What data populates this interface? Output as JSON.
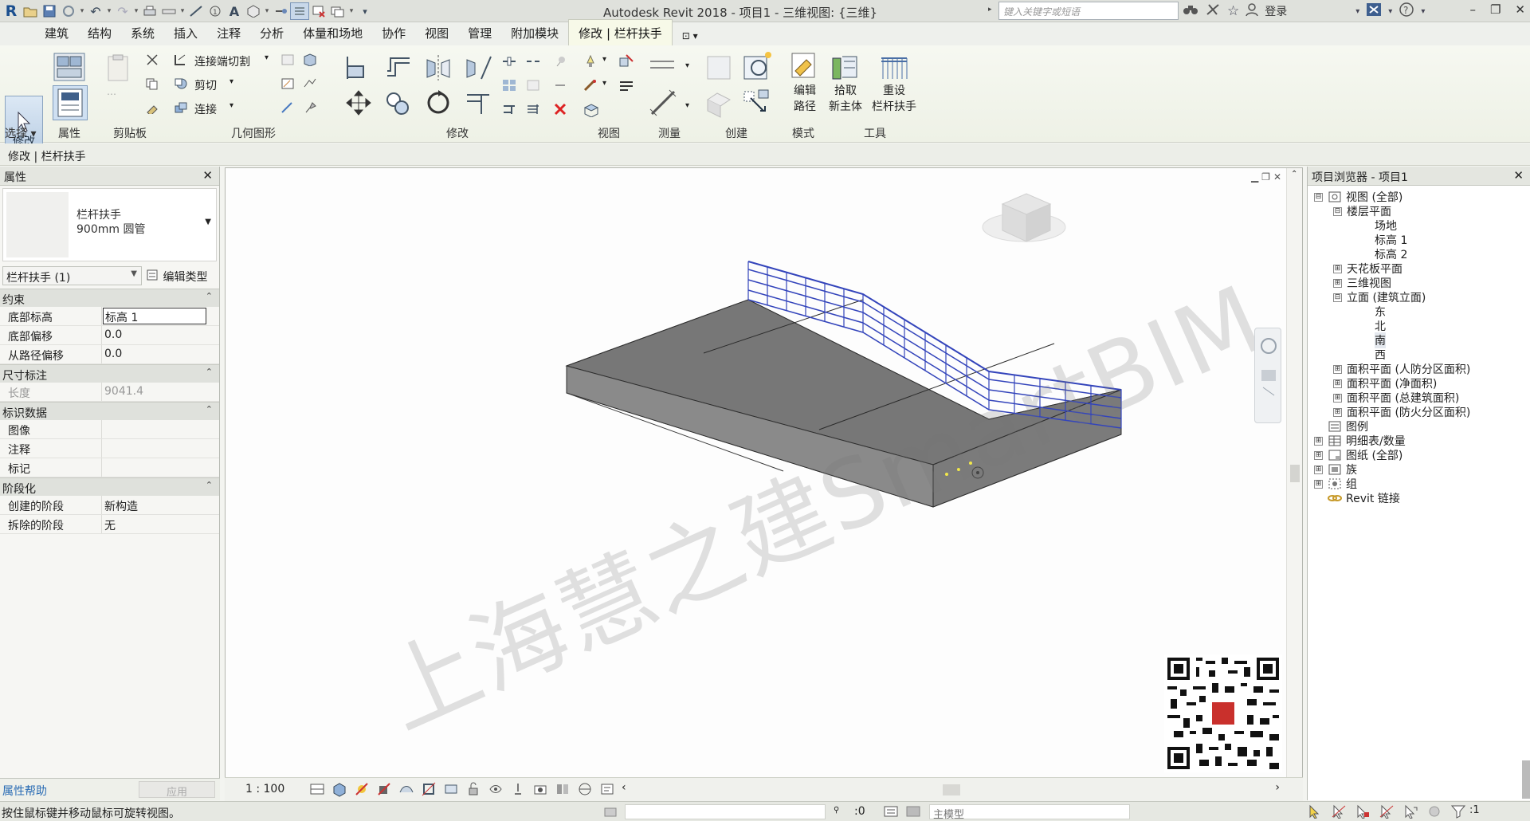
{
  "app": {
    "title": "Autodesk Revit 2018 -    项目1 - 三维视图: {三维}",
    "search_placeholder": "键入关键字或短语",
    "login": "登录"
  },
  "quick_access": {
    "icons": [
      "revit-logo-icon",
      "open-icon",
      "save-icon",
      "sync-icon",
      "undo-icon",
      "redo-icon",
      "print-icon",
      "measure-icon",
      "dimension-icon",
      "tag-icon",
      "text-icon",
      "3d-view-icon",
      "section-icon",
      "thin-lines-icon",
      "close-hidden-icon",
      "switch-windows-icon",
      "customize-icon"
    ]
  },
  "tabs": [
    {
      "label": "建筑"
    },
    {
      "label": "结构"
    },
    {
      "label": "系统"
    },
    {
      "label": "插入"
    },
    {
      "label": "注释"
    },
    {
      "label": "分析"
    },
    {
      "label": "体量和场地"
    },
    {
      "label": "协作"
    },
    {
      "label": "视图"
    },
    {
      "label": "管理"
    },
    {
      "label": "附加模块"
    },
    {
      "label": "修改 | 栏杆扶手"
    }
  ],
  "ribbon": {
    "modify_label": "修改",
    "select_label": "选择 ▾",
    "properties_label": "属性",
    "clipboard_label": "剪贴板",
    "geometry_label": "几何图形",
    "modify_panel_label": "修改",
    "view_panel_label": "视图",
    "measure_panel_label": "测量",
    "create_panel_label": "创建",
    "mode_panel_label": "模式",
    "tools_panel_label": "工具",
    "cope_label": "连接端切割",
    "cut_label": "剪切",
    "join_label": "连接",
    "edit_path_label": "编辑\n路径",
    "edit_path_l1": "编辑",
    "edit_path_l2": "路径",
    "pick_host_l1": "拾取",
    "pick_host_l2": "新主体",
    "reset_rail_l1": "重设",
    "reset_rail_l2": "栏杆扶手"
  },
  "options_bar": {
    "context": "修改 | 栏杆扶手"
  },
  "properties": {
    "title": "属性",
    "type_name": "栏杆扶手",
    "type_sub": "900mm 圆管",
    "instance_selector": "栏杆扶手 (1)",
    "edit_type": "编辑类型",
    "groups": [
      {
        "name": "约束",
        "rows": [
          {
            "key": "底部标高",
            "value": "标高 1"
          },
          {
            "key": "底部偏移",
            "value": "0.0"
          },
          {
            "key": "从路径偏移",
            "value": "0.0"
          }
        ]
      },
      {
        "name": "尺寸标注",
        "rows": [
          {
            "key": "长度",
            "value": "9041.4"
          }
        ]
      },
      {
        "name": "标识数据",
        "rows": [
          {
            "key": "图像",
            "value": ""
          },
          {
            "key": "注释",
            "value": ""
          },
          {
            "key": "标记",
            "value": ""
          }
        ]
      },
      {
        "name": "阶段化",
        "rows": [
          {
            "key": "创建的阶段",
            "value": "新构造"
          },
          {
            "key": "拆除的阶段",
            "value": "无"
          }
        ]
      }
    ],
    "help": "属性帮助",
    "apply": "应用"
  },
  "viewport": {
    "watermark": "上海慧之建SmartBIM",
    "scale": "1 : 100"
  },
  "project_browser": {
    "title": "项目浏览器 - 项目1",
    "nodes": [
      {
        "label": "视图 (全部)",
        "toggle": "⊟"
      },
      {
        "label": "楼层平面",
        "toggle": "⊟"
      },
      {
        "label": "场地",
        "toggle": ""
      },
      {
        "label": "标高 1",
        "toggle": ""
      },
      {
        "label": "标高 2",
        "toggle": ""
      },
      {
        "label": "天花板平面",
        "toggle": "⊞"
      },
      {
        "label": "三维视图",
        "toggle": "⊞"
      },
      {
        "label": "立面 (建筑立面)",
        "toggle": "⊟"
      },
      {
        "label": "东",
        "toggle": ""
      },
      {
        "label": "北",
        "toggle": ""
      },
      {
        "label": "南",
        "toggle": ""
      },
      {
        "label": "西",
        "toggle": ""
      },
      {
        "label": "面积平面 (人防分区面积)",
        "toggle": "⊞"
      },
      {
        "label": "面积平面 (净面积)",
        "toggle": "⊞"
      },
      {
        "label": "面积平面 (总建筑面积)",
        "toggle": "⊞"
      },
      {
        "label": "面积平面 (防火分区面积)",
        "toggle": "⊞"
      },
      {
        "label": "图例",
        "toggle": ""
      },
      {
        "label": "明细表/数量",
        "toggle": "⊞"
      },
      {
        "label": "图纸 (全部)",
        "toggle": "⊞"
      },
      {
        "label": "族",
        "toggle": "⊞"
      },
      {
        "label": "组",
        "toggle": "⊞"
      },
      {
        "label": "Revit 链接",
        "toggle": ""
      }
    ]
  },
  "status_bar": {
    "message": "按住鼠标键并移动鼠标可旋转视图。",
    "selection_count": ":0",
    "model": "主模型",
    "filter_count": ":1"
  }
}
